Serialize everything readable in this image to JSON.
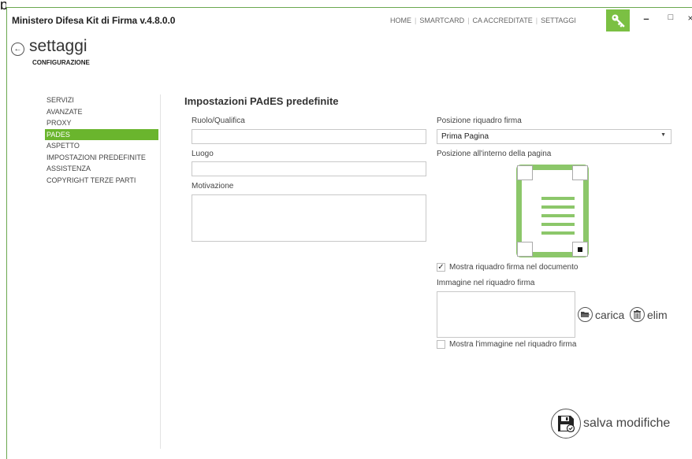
{
  "artifact": {
    "glyph": "p"
  },
  "window": {
    "title": "Ministero Difesa Kit di Firma v.4.8.0.0",
    "nav": [
      "HOME",
      "SMARTCARD",
      "CA ACCREDITATE",
      "SETTAGGI"
    ],
    "controls": {
      "minimize": "–",
      "maximize": "□",
      "close": "×"
    },
    "accent_color": "#7bc043"
  },
  "header": {
    "title": "settaggi",
    "subtitle": "CONFIGURAZIONE"
  },
  "sidebar": {
    "items": [
      {
        "label": "SERVIZI",
        "active": false
      },
      {
        "label": "AVANZATE",
        "active": false
      },
      {
        "label": "PROXY",
        "active": false
      },
      {
        "label": "PADES",
        "active": true
      },
      {
        "label": "ASPETTO",
        "active": false
      },
      {
        "label": "IMPOSTAZIONI PREDEFINITE",
        "active": false
      },
      {
        "label": "ASSISTENZA",
        "active": false
      },
      {
        "label": "COPYRIGHT TERZE PARTI",
        "active": false
      }
    ]
  },
  "form": {
    "section_title": "Impostazioni PAdES predefinite",
    "role_label": "Ruolo/Qualifica",
    "role_value": "",
    "place_label": "Luogo",
    "place_value": "",
    "reason_label": "Motivazione",
    "reason_value": "",
    "position_label": "Posizione riquadro firma",
    "position_value": "Prima Pagina",
    "page_position_label": "Posizione all'interno della pagina",
    "selected_corner": "bottom-right",
    "show_box_label": "Mostra riquadro firma nel documento",
    "show_box_checked": true,
    "image_label": "Immagine nel riquadro firma",
    "load_label": "carica",
    "delete_label": "elim",
    "show_image_label": "Mostra l'immagine nel riquadro firma",
    "show_image_checked": false,
    "save_label": "salva modifiche"
  }
}
